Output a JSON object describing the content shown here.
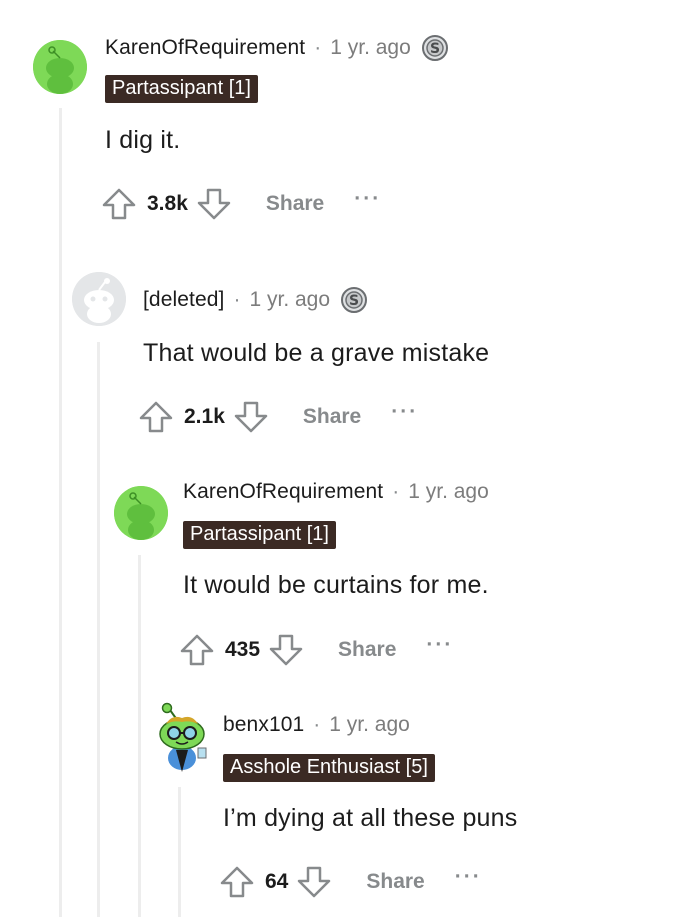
{
  "comments": [
    {
      "username": "KarenOfRequirement",
      "separator": "·",
      "time": "1 yr. ago",
      "flair": "Partassipant [1]",
      "body": "I dig it.",
      "score": "3.8k",
      "share_label": "Share",
      "more_label": "···",
      "avatar_color": "#7ed957"
    },
    {
      "username": "[deleted]",
      "separator": "·",
      "time": "1 yr. ago",
      "flair": "",
      "body": "That would be a grave mistake",
      "score": "2.1k",
      "share_label": "Share",
      "more_label": "···",
      "avatar_color": "#e4e6e8"
    },
    {
      "username": "KarenOfRequirement",
      "separator": "·",
      "time": "1 yr. ago",
      "flair": "Partassipant [1]",
      "body": "It would be curtains for me.",
      "score": "435",
      "share_label": "Share",
      "more_label": "···",
      "avatar_color": "#7ed957"
    },
    {
      "username": "benx101",
      "separator": "·",
      "time": "1 yr. ago",
      "flair": "Asshole Enthusiast [5]",
      "body": "I’m dying at all these puns",
      "score": "64",
      "share_label": "Share",
      "more_label": "···",
      "avatar_color": "#ffffff"
    }
  ],
  "colors": {
    "flair_bg": "#3b2a24",
    "muted_text": "#878a8c",
    "thread_line": "#ededed"
  }
}
